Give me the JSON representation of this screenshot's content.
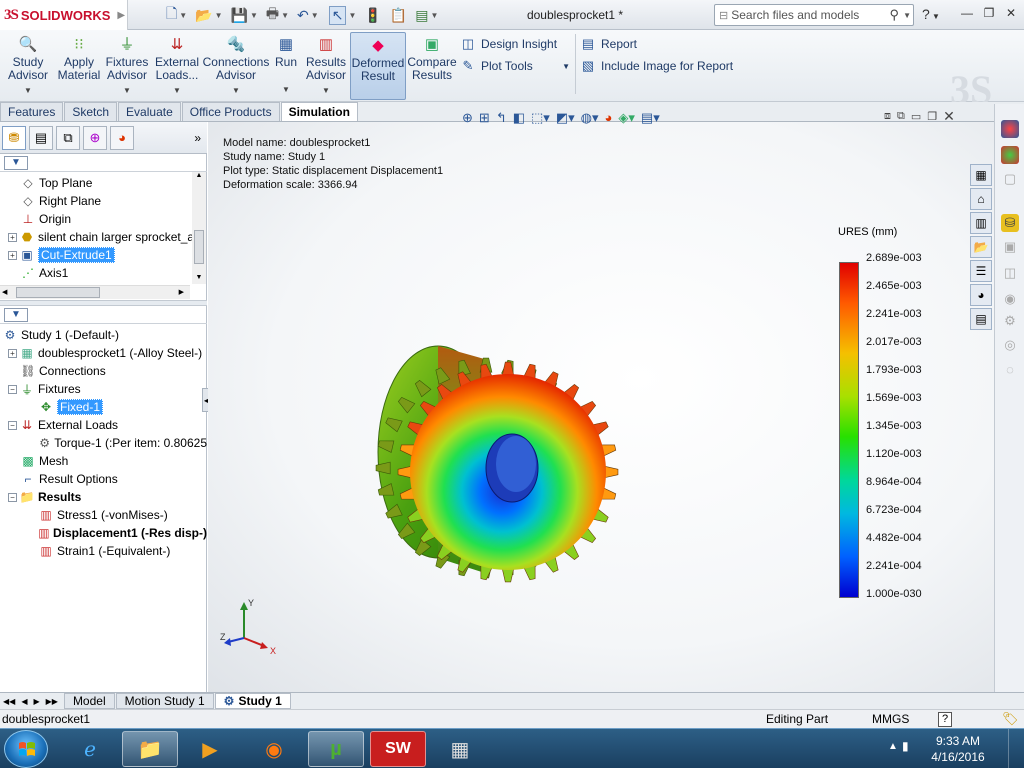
{
  "app": {
    "brand_ds": "3S",
    "brand_name": "SOLIDWORKS",
    "document_title": "doublesprocket1 *",
    "search_placeholder": "Search files and models",
    "help_glyph": "?"
  },
  "ribbon": {
    "buttons": [
      {
        "label1": "Study",
        "label2": "Advisor",
        "icon": "study-advisor-icon"
      },
      {
        "label1": "Apply",
        "label2": "Material",
        "icon": "apply-material-icon"
      },
      {
        "label1": "Fixtures",
        "label2": "Advisor",
        "icon": "fixtures-icon"
      },
      {
        "label1": "External",
        "label2": "Loads...",
        "icon": "external-loads-icon"
      },
      {
        "label1": "Connections",
        "label2": "Advisor",
        "icon": "connections-icon"
      },
      {
        "label1": "Run",
        "label2": "",
        "icon": "run-icon"
      },
      {
        "label1": "Results",
        "label2": "Advisor",
        "icon": "results-advisor-icon"
      },
      {
        "label1": "Deformed",
        "label2": "Result",
        "icon": "deformed-result-icon"
      },
      {
        "label1": "Compare",
        "label2": "Results",
        "icon": "compare-results-icon"
      }
    ],
    "design_insight": "Design Insight",
    "plot_tools": "Plot Tools",
    "report": "Report",
    "include_image": "Include Image for Report"
  },
  "tabs": [
    "Features",
    "Sketch",
    "Evaluate",
    "Office Products",
    "Simulation"
  ],
  "active_tab": "Simulation",
  "feature_tree": [
    {
      "label": "Top Plane",
      "icon": "plane-icon"
    },
    {
      "label": "Right Plane",
      "icon": "plane-icon"
    },
    {
      "label": "Origin",
      "icon": "origin-icon"
    },
    {
      "label": "silent chain larger sprocket_a",
      "icon": "part-feature-icon"
    },
    {
      "label": "Cut-Extrude1",
      "icon": "cut-extrude-icon"
    },
    {
      "label": "Axis1",
      "icon": "axis-icon"
    }
  ],
  "sim_tree": {
    "study": "Study 1 (-Default-)",
    "part": "doublesprocket1 (-Alloy Steel-)",
    "connections": "Connections",
    "fixtures": "Fixtures",
    "fixed": "Fixed-1",
    "external_loads": "External Loads",
    "torque": "Torque-1 (:Per item: 0.80625",
    "mesh": "Mesh",
    "result_options": "Result Options",
    "results": "Results",
    "stress": "Stress1 (-vonMises-)",
    "displacement": "Displacement1 (-Res disp-)",
    "strain": "Strain1 (-Equivalent-)"
  },
  "plot_info": {
    "model_name": "Model name: doublesprocket1",
    "study_name": "Study name: Study 1",
    "plot_type": "Plot type: Static displacement Displacement1",
    "deformation_scale": "Deformation scale: 3366.94"
  },
  "legend": {
    "title": "URES (mm)",
    "ticks": [
      "2.689e-003",
      "2.465e-003",
      "2.241e-003",
      "2.017e-003",
      "1.793e-003",
      "1.569e-003",
      "1.345e-003",
      "1.120e-003",
      "8.964e-004",
      "6.723e-004",
      "4.482e-004",
      "2.241e-004",
      "1.000e-030"
    ]
  },
  "triad": {
    "x": "X",
    "y": "Y",
    "z": "Z"
  },
  "bottom_tabs": [
    "Model",
    "Motion Study 1",
    "Study 1"
  ],
  "status": {
    "left": "doublesprocket1",
    "mode": "Editing Part",
    "units": "MMGS",
    "help": "?"
  },
  "clock": {
    "time": "9:33 AM",
    "date": "4/16/2016"
  },
  "taskbar_apps": [
    "internet-explorer-icon",
    "file-explorer-icon",
    "media-player-icon",
    "firefox-icon",
    "utorrent-icon",
    "solidworks-app-icon",
    "calculator-icon"
  ]
}
